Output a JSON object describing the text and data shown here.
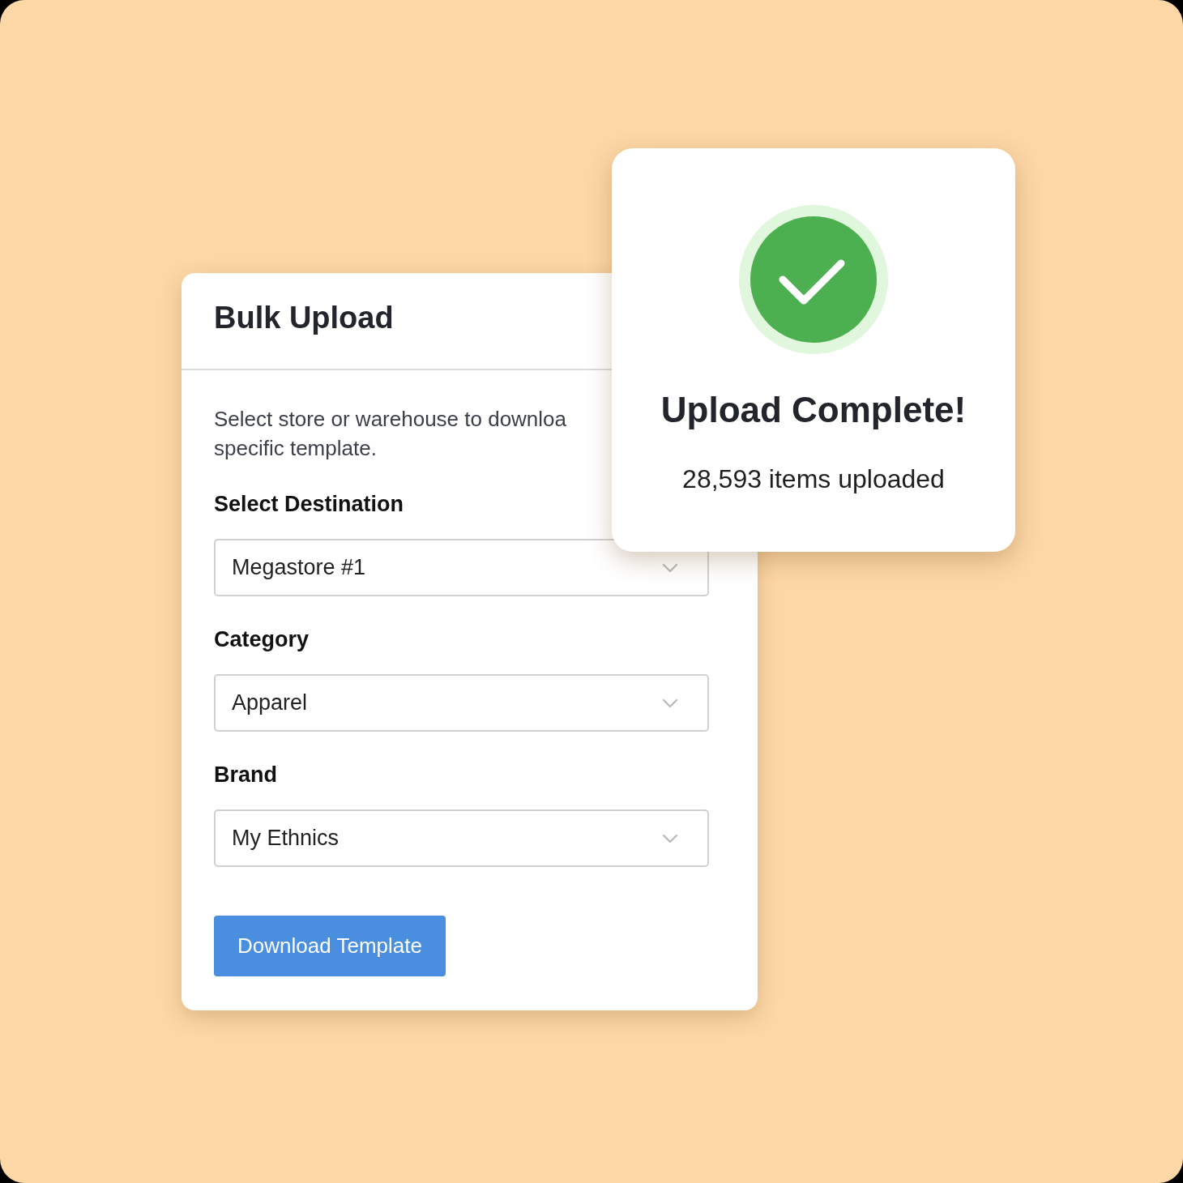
{
  "upload_form": {
    "title": "Bulk Upload",
    "description_lines": [
      "Select store or warehouse to downloa",
      "specific template."
    ],
    "fields": [
      {
        "label": "Select Destination",
        "value": "Megastore #1"
      },
      {
        "label": "Category",
        "value": "Apparel"
      },
      {
        "label": "Brand",
        "value": "My Ethnics"
      }
    ],
    "button": "Download Template"
  },
  "success_dialog": {
    "title": "Upload Complete!",
    "message": "28,593 items uploaded"
  }
}
